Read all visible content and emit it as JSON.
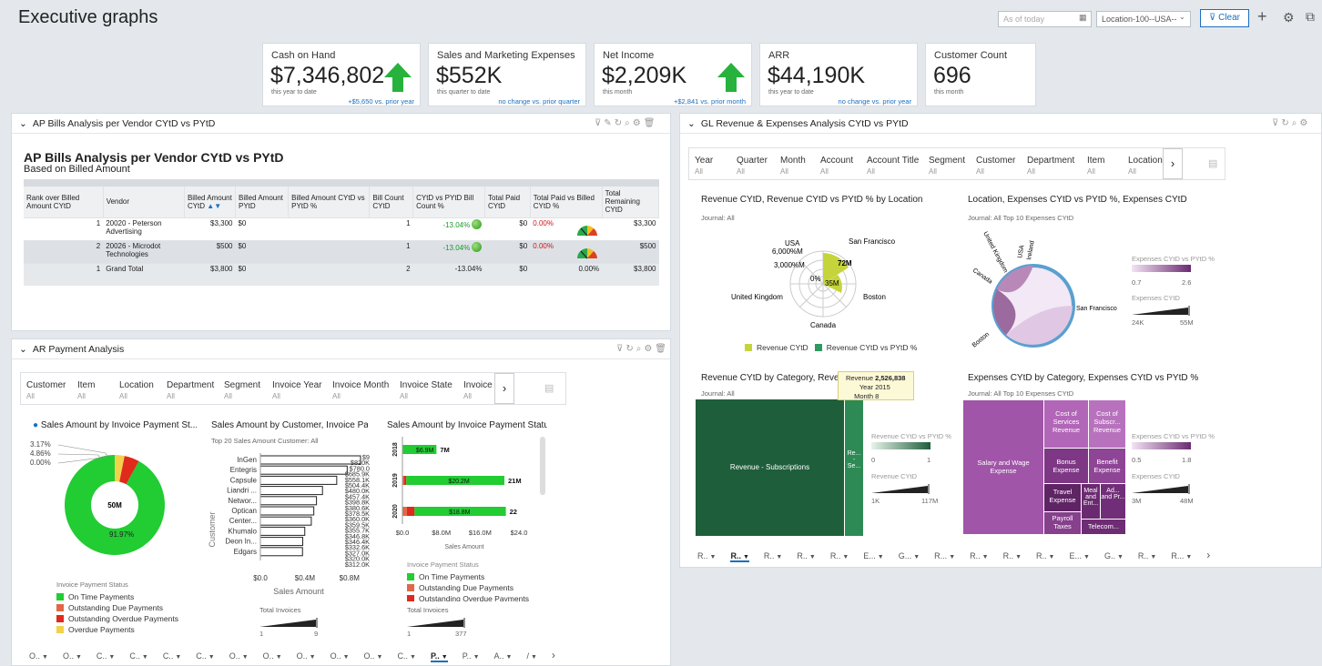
{
  "page": {
    "title": "Executive graphs"
  },
  "controls": {
    "date_placeholder": "As of today",
    "location": "Location-100--USA--",
    "clear": "Clear"
  },
  "kpis": [
    {
      "title": "Cash on Hand",
      "value": "$7,346,802",
      "sub": "this year to date",
      "change": "+$5,650 vs. prior year",
      "arrow": true
    },
    {
      "title": "Sales and Marketing Expenses",
      "value": "$552K",
      "sub": "this quarter to date",
      "change": "no change vs. prior quarter",
      "arrow": false
    },
    {
      "title": "Net Income",
      "value": "$2,209K",
      "sub": "this month",
      "change": "+$2,841 vs. prior month",
      "arrow": true
    },
    {
      "title": "ARR",
      "value": "$44,190K",
      "sub": "this year to date",
      "change": "no change vs. prior year",
      "arrow": false
    },
    {
      "title": "Customer Count",
      "value": "696",
      "sub": "this month",
      "change": "",
      "arrow": false
    }
  ],
  "ap": {
    "panel_title": "AP Bills Analysis per Vendor CYtD vs PYtD",
    "report_title": "AP Bills Analysis per Vendor CYtD vs PYtD",
    "report_subtitle": "Based on Billed Amount",
    "headers": [
      "Rank over Billed Amount CYtD",
      "Vendor",
      "Billed Amount CYtD",
      "Billed Amount PYtD",
      "Billed Amount CYtD vs PYtD %",
      "Bill Count CYtD",
      "CYtD vs PYtD Bill Count %",
      "Total Paid CYtD",
      "Total Paid vs Billed CYtD %",
      "Total Remaining CYtD"
    ],
    "rows": [
      {
        "rank": "1",
        "vendor": "20020 - Peterson Advertising",
        "billed": "$3,300",
        "pytd": "$0",
        "pct": "",
        "count": "1",
        "count_pct": "-13.04%",
        "paid": "$0",
        "paid_pct": "0.00%",
        "remaining": "$3,300"
      },
      {
        "rank": "2",
        "vendor": "20026 - Microdot Technologies",
        "billed": "$500",
        "pytd": "$0",
        "pct": "",
        "count": "1",
        "count_pct": "-13.04%",
        "paid": "$0",
        "paid_pct": "0.00%",
        "remaining": "$500"
      },
      {
        "rank": "1",
        "vendor": "Grand Total",
        "billed": "$3,800",
        "pytd": "$0",
        "pct": "",
        "count": "2",
        "count_pct": "-13.04%",
        "paid": "$0",
        "paid_pct": "0.00%",
        "remaining": "$3,800"
      }
    ]
  },
  "gl": {
    "panel_title": "GL Revenue & Expenses Analysis CYtD vs PYtD",
    "filters": [
      {
        "label": "Year",
        "value": "All"
      },
      {
        "label": "Quarter",
        "value": "All"
      },
      {
        "label": "Month",
        "value": "All"
      },
      {
        "label": "Account",
        "value": "All"
      },
      {
        "label": "Account Title",
        "value": "All"
      },
      {
        "label": "Segment",
        "value": "All"
      },
      {
        "label": "Customer",
        "value": "All"
      },
      {
        "label": "Department",
        "value": "All"
      },
      {
        "label": "Item",
        "value": "All"
      },
      {
        "label": "Location",
        "value": "All"
      }
    ],
    "c1_title": "Revenue CYtD, Revenue CYtD vs PYtD % by Location",
    "c1_journal": "Journal: All",
    "c1_labels": [
      "USA",
      "6,000%M",
      "3,000%M",
      "0%",
      "72M",
      "35M",
      "San Francisco",
      "United Kingdom",
      "Boston",
      "Canada"
    ],
    "c1_legend": [
      "Revenue CYtD",
      "Revenue CYtD vs PYtD %"
    ],
    "c2_title": "Location, Expenses CYtD vs PYtD %, Expenses CYtD",
    "c2_journal": "Journal: All   Top 10 Expenses CYtD",
    "c2_labels": [
      "United Kingdom",
      "USA",
      "Ireland",
      "Canada",
      "Boston",
      "San Francisco"
    ],
    "c2_scale": {
      "pct_title": "Expenses CYtD vs PYtD %",
      "pct_min": "0.7",
      "pct_max": "2.6",
      "val_title": "Expenses CYtD",
      "val_min": "24K",
      "val_max": "55M"
    },
    "c3_title": "Revenue CYtD by Category, Revenue CYtD vs PYtD %",
    "c3_journal": "Journal: All",
    "c3_block": "Revenue - Subscriptions",
    "c3_small": "Re... - Se...",
    "c3_tooltip": {
      "l1": "Revenue",
      "v1": "2,526,838",
      "l2": "Year",
      "v2": "2015",
      "l3": "Month",
      "v3": "8"
    },
    "c3_scale": {
      "pct_title": "Revenue CYtD vs PYtD %",
      "pct_min": "0",
      "pct_max": "1",
      "val_title": "Revenue CYtD",
      "val_min": "1K",
      "val_max": "117M"
    },
    "c4_title": "Expenses CYtD by Category, Expenses CYtD vs PYtD %",
    "c4_journal": "Journal: All   Top 10 Expenses CYtD",
    "c4_cells": [
      "Salary and Wage Expense",
      "Cost of Services Revenue",
      "Cost of Subscr... Revenue",
      "Bonus Expense",
      "Benefit Expense",
      "Travel Expense",
      "Meal and Ent...",
      "Ad... and Pr...",
      "Payroll Taxes",
      "Telecom..."
    ],
    "c4_scale": {
      "pct_title": "Expenses CYtD vs PYtD %",
      "pct_min": "0.5",
      "pct_max": "1.8",
      "val_title": "Expenses CYtD",
      "val_min": "3M",
      "val_max": "48M"
    },
    "tabs": [
      "R..",
      "R..",
      "R..",
      "R..",
      "R..",
      "E...",
      "G...",
      "R...",
      "R..",
      "R..",
      "R..",
      "E...",
      "G..",
      "R..",
      "R..."
    ]
  },
  "ar": {
    "panel_title": "AR Payment Analysis",
    "filters": [
      {
        "label": "Customer",
        "value": "All"
      },
      {
        "label": "Item",
        "value": "All"
      },
      {
        "label": "Location",
        "value": "All"
      },
      {
        "label": "Department",
        "value": "All"
      },
      {
        "label": "Segment",
        "value": "All"
      },
      {
        "label": "Invoice Year",
        "value": "All"
      },
      {
        "label": "Invoice Month",
        "value": "All"
      },
      {
        "label": "Invoice State",
        "value": "All"
      },
      {
        "label": "Invoice P",
        "value": "All"
      }
    ],
    "tabs": [
      "O..",
      "O..",
      "C..",
      "C..",
      "C..",
      "C..",
      "O..",
      "O..",
      "O..",
      "O..",
      "O..",
      "C..",
      "P..",
      "P..",
      "A..",
      "/"
    ]
  },
  "chart_data": [
    {
      "type": "pie",
      "title": "Sales Amount by Invoice Payment St...",
      "categories": [
        "On Time Payments",
        "Outstanding Due Payments",
        "Outstanding Overdue Payments",
        "Overdue Payments"
      ],
      "values": [
        91.97,
        0.0,
        4.86,
        3.17
      ],
      "value_labels": [
        "91.97%",
        "0.00%",
        "4.86%",
        "3.17%"
      ],
      "center_label": "50M",
      "legend_title": "Invoice Payment Status",
      "colors": [
        "#22cc33",
        "#e06848",
        "#e02a1c",
        "#f2d24a"
      ]
    },
    {
      "type": "bar",
      "title": "Sales Amount by Customer, Invoice Pa...",
      "subtitle": "Top 20 Sales Amount   Customer: All",
      "categories": [
        "InGen",
        "Entegris",
        "Capsule",
        "Liandri ...",
        "Networ...",
        "Optican",
        "Center...",
        "Khumalo",
        "Deon In...",
        "Edgars"
      ],
      "values": [
        0.9,
        0.78,
        0.6859,
        0.5581,
        0.504,
        0.48,
        0.4574,
        0.3988,
        0.3806,
        0.3785
      ],
      "labels": [
        "$9",
        "$820K",
        "$780.0",
        "$685.9K",
        "$558.1K",
        "$504.4K",
        "$480.0K",
        "$457.4K",
        "$398.8K",
        "$380.6K",
        "$378.5K",
        "$360.0K",
        "$359.5K",
        "$355.7K",
        "$346.8K",
        "$346.4K",
        "$332.6K",
        "$327.0K",
        "$320.0K",
        "$312.0K"
      ],
      "xlabel": "Sales Amount",
      "ylabel": "Customer",
      "xticks": [
        "$0.0",
        "$0.4M",
        "$0.8M"
      ],
      "xlim": [
        0,
        0.9
      ],
      "legend_title": "Total Invoices",
      "legend_min": "1",
      "legend_max": "9"
    },
    {
      "type": "bar",
      "title": "Sales Amount by Invoice Payment Statu...",
      "categories": [
        "2018",
        "2019",
        "2020"
      ],
      "series": [
        {
          "name": "On Time Payments",
          "values": [
            6.9,
            20.2,
            18.8
          ]
        },
        {
          "name": "Outstanding Due Payments",
          "values": [
            0,
            0.3,
            0.9
          ]
        },
        {
          "name": "Outstanding Overdue Payments",
          "values": [
            0.1,
            0.5,
            1.6
          ]
        }
      ],
      "bar_labels": [
        "$6.9M",
        "$20.2M",
        "$18.8M"
      ],
      "totals": [
        "7M",
        "21M",
        "22"
      ],
      "xlabel": "Sales Amount",
      "xticks": [
        "$0.0",
        "$8.0M",
        "$16.0M",
        "$24.0"
      ],
      "xlim": [
        0,
        24
      ],
      "legend_title": "Invoice Payment Status",
      "legend": [
        "On Time Payments",
        "Outstanding Due Payments",
        "Outstanding Overdue Payments"
      ],
      "size_title": "Total Invoices",
      "size_min": "1",
      "size_max": "377"
    }
  ]
}
